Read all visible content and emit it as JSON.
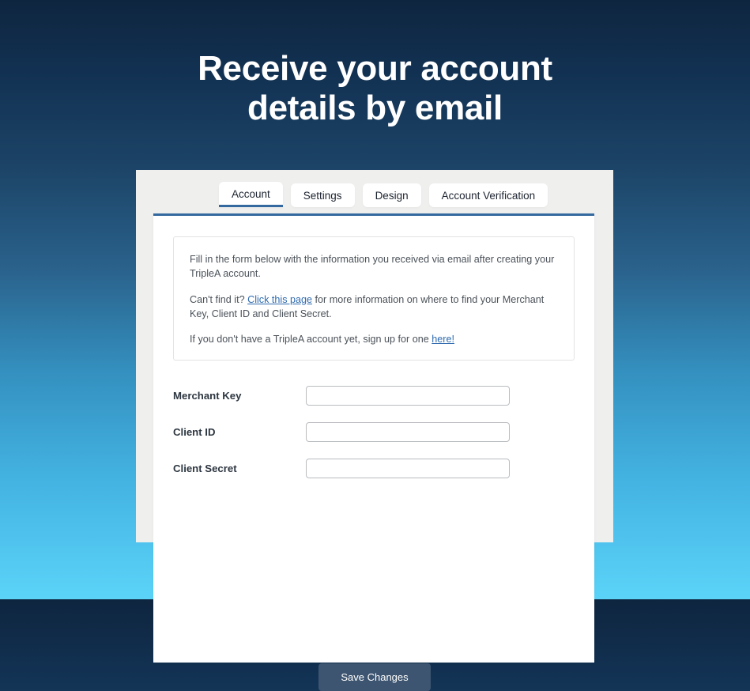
{
  "hero": {
    "title": "Receive your account details by email"
  },
  "tabs": [
    {
      "label": "Account",
      "active": true
    },
    {
      "label": "Settings",
      "active": false
    },
    {
      "label": "Design",
      "active": false
    },
    {
      "label": "Account Verification",
      "active": false
    }
  ],
  "info": {
    "paragraph_1": "Fill in the form below with the information you received via email after creating your TripleA account.",
    "paragraph_2_before": "Can't find it? ",
    "paragraph_2_link": "Click this page",
    "paragraph_2_after": " for more information on where to find your Merchant Key, Client ID and Client Secret.",
    "paragraph_3_before": "If you don't have a TripleA account yet, sign up for one ",
    "paragraph_3_link": "here!",
    "paragraph_3_after": ""
  },
  "form": {
    "fields": [
      {
        "label": "Merchant Key",
        "value": "",
        "placeholder": ""
      },
      {
        "label": "Client ID",
        "value": "",
        "placeholder": ""
      },
      {
        "label": "Client Secret",
        "value": "",
        "placeholder": ""
      }
    ]
  },
  "footer": {
    "save_label": "Save Changes"
  },
  "colors": {
    "background_top": "#0e253f",
    "background_bottom": "#5bd3f8",
    "accent_border": "#33699e",
    "link": "#2f6bb0",
    "button": "#3d5570",
    "card_background": "#efefee"
  }
}
